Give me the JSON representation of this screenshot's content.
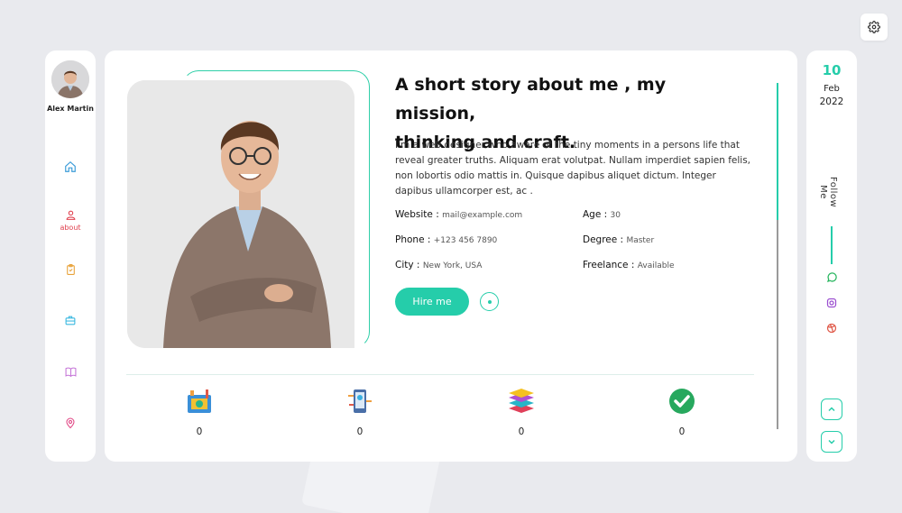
{
  "profile": {
    "name": "Alex Martin"
  },
  "nav": {
    "about_label": "about"
  },
  "about": {
    "heading_line1": "A short story about me , my mission,",
    "heading_line2": "thinking and craft.",
    "bio": "I'm a web designer who aware of the tiny moments in a persons life that reveal greater truths. Aliquam erat volutpat. Nullam imperdiet sapien felis, non lobortis odio mattis in. Quisque dapibus aliquet dictum. Integer dapibus ullamcorper est, ac .",
    "info": {
      "website_label": "Website :",
      "website_value": "mail@example.com",
      "phone_label": "Phone :",
      "phone_value": "+123 456 7890",
      "city_label": "City :",
      "city_value": "New York, USA",
      "age_label": "Age :",
      "age_value": "30",
      "degree_label": "Degree :",
      "degree_value": "Master",
      "freelance_label": "Freelance :",
      "freelance_value": "Available"
    },
    "hire_label": "Hire me"
  },
  "stats": [
    {
      "icon": "projects-icon",
      "value": "0"
    },
    {
      "icon": "mobile-design-icon",
      "value": "0"
    },
    {
      "icon": "layers-icon",
      "value": "0"
    },
    {
      "icon": "check-badge-icon",
      "value": "0"
    }
  ],
  "date": {
    "day": "10",
    "month": "Feb",
    "year": "2022"
  },
  "follow_label": "Follow Me",
  "colors": {
    "accent": "#25cdaa",
    "nav_active": "#e0404e"
  }
}
